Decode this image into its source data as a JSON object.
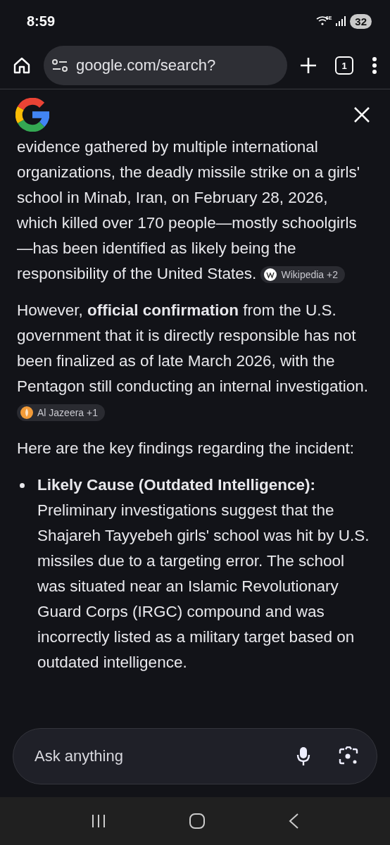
{
  "status_bar": {
    "time": "8:59",
    "wifi_label": "6E",
    "battery": "32"
  },
  "browser": {
    "url": "google.com/search?",
    "tab_count": "1"
  },
  "answer": {
    "paragraphs": [
      {
        "text": "evidence gathered by multiple international organizations, the deadly missile strike on a girls' school in Minab, Iran, on February 28, 2026, which killed over 170 people—mostly schoolgirls—has been identified as likely being the responsibility of the United States.",
        "source": {
          "label": "Wikipedia +2",
          "kind": "wikipedia"
        }
      },
      {
        "text": "However, **official confirmation** from the U.S. government that it is directly responsible has not been finalized as of late March 2026, with the Pentagon still conducting an internal investigation.",
        "source": {
          "label": "Al Jazeera +1",
          "kind": "aljazeera"
        }
      },
      {
        "text": "Here are the key findings regarding the incident:"
      }
    ],
    "findings": [
      {
        "title": "Likely Cause (Outdated Intelligence):",
        "text": "Preliminary investigations suggest that the Shajareh Tayyebeh girls' school was hit by U.S. missiles due to a targeting error. The school was situated near an Islamic Revolutionary Guard Corps (IRGC) compound and was incorrectly listed as a military target based on outdated intelligence."
      }
    ]
  },
  "ask_bar": {
    "placeholder": "Ask anything"
  }
}
